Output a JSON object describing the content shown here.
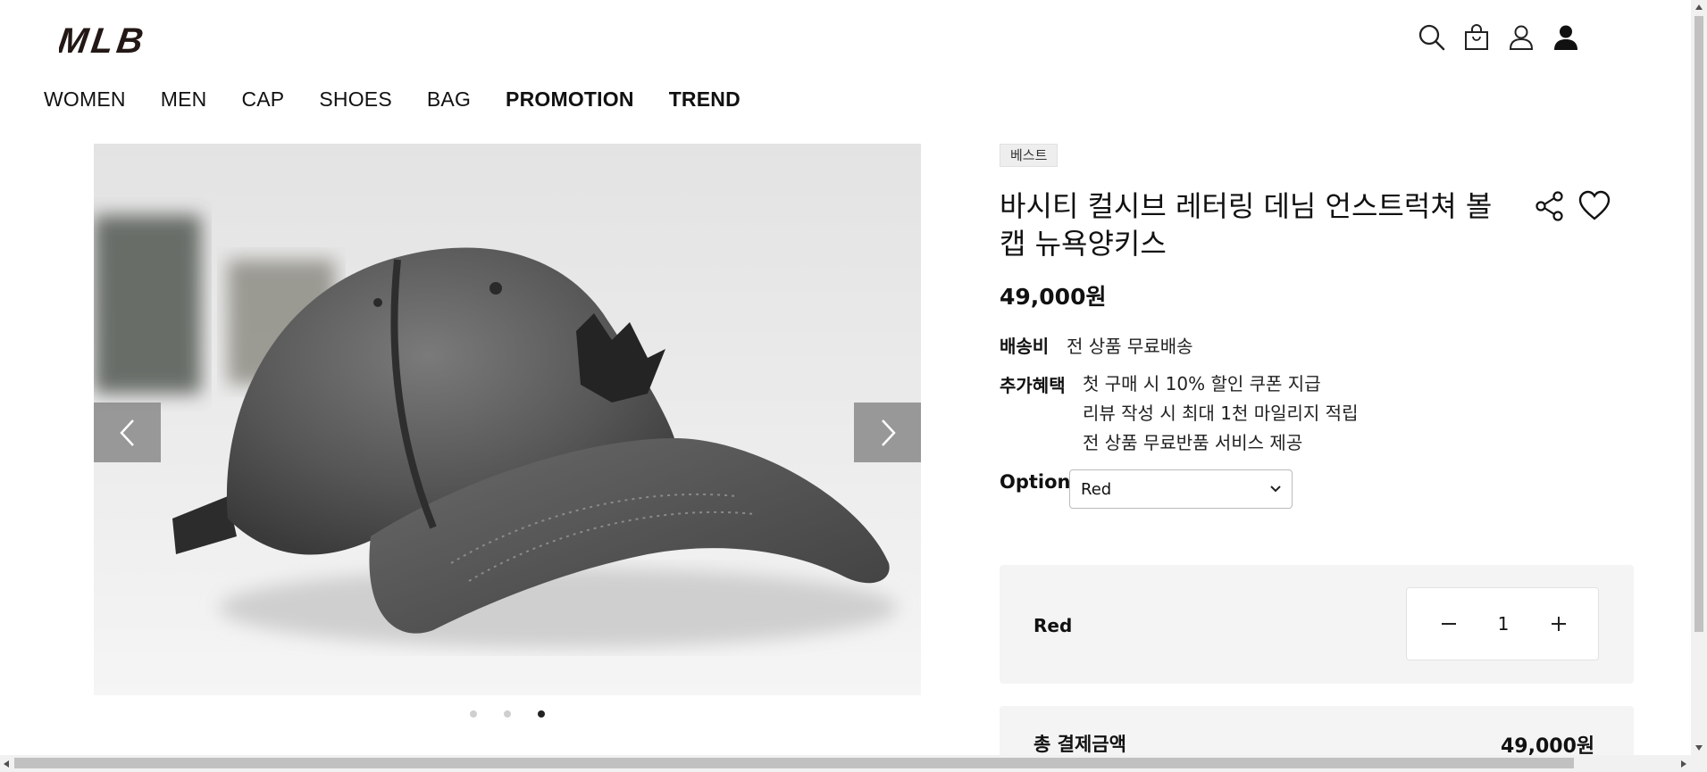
{
  "header": {
    "brand": "MLB",
    "icons": [
      "search-icon",
      "shopping-bag-icon",
      "user-outline-icon",
      "user-filled-icon"
    ]
  },
  "nav": {
    "items": [
      {
        "label": "WOMEN",
        "bold": false
      },
      {
        "label": "MEN",
        "bold": false
      },
      {
        "label": "CAP",
        "bold": false
      },
      {
        "label": "SHOES",
        "bold": false
      },
      {
        "label": "BAG",
        "bold": false
      },
      {
        "label": "PROMOTION",
        "bold": true
      },
      {
        "label": "TREND",
        "bold": true
      }
    ]
  },
  "gallery": {
    "slide_count": 3,
    "active_slide": 3,
    "image": "gray washed denim baseball cap"
  },
  "product": {
    "badge": "베스트",
    "title": "바시티 컬시브 레터링 데님 언스트럭쳐 볼캡 뉴욕양키스",
    "price": "49,000원",
    "shipping_label": "배송비",
    "shipping_value": "전 상품 무료배송",
    "benefits_label": "추가혜택",
    "benefits": [
      "첫 구매 시 10% 할인 쿠폰 지급",
      "리뷰 작성 시 최대 1천 마일리지 적립",
      "전 상품 무료반품 서비스 제공"
    ],
    "option_label": "Option",
    "option_value": "Red"
  },
  "selection": {
    "name": "Red",
    "quantity": "1"
  },
  "total": {
    "label": "총 결제금액",
    "value": "49,000원"
  },
  "colors": {
    "accent": "#111111",
    "panel": "#f4f4f4",
    "arrow_bg": "#808080"
  }
}
